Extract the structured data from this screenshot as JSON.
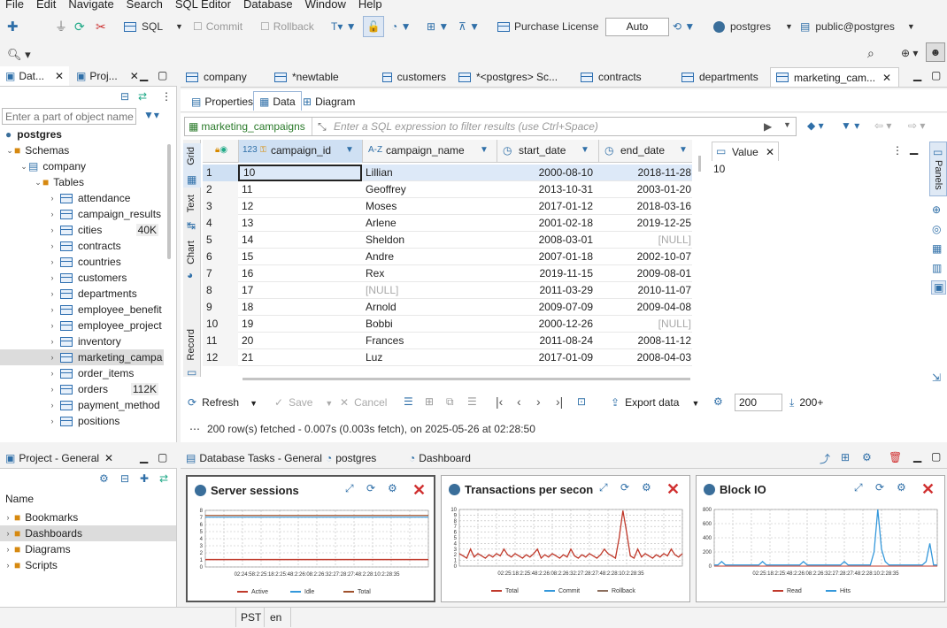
{
  "menu": [
    "File",
    "Edit",
    "Navigate",
    "Search",
    "SQL Editor",
    "Database",
    "Window",
    "Help"
  ],
  "toolbar": {
    "sql": "SQL",
    "commit": "Commit",
    "rollback": "Rollback",
    "purchase": "Purchase License",
    "auto": "Auto",
    "connection": "postgres",
    "schema": "public@postgres"
  },
  "nav": {
    "tab1": "Dat...",
    "tab2": "Proj...",
    "filter_placeholder": "Enter a part of object name h"
  },
  "tree": {
    "root": "postgres",
    "schemas": "Schemas",
    "company": "company",
    "tables": "Tables",
    "items": [
      {
        "name": "attendance",
        "size": ""
      },
      {
        "name": "campaign_results",
        "size": ""
      },
      {
        "name": "cities",
        "size": "40K"
      },
      {
        "name": "contracts",
        "size": ""
      },
      {
        "name": "countries",
        "size": ""
      },
      {
        "name": "customers",
        "size": ""
      },
      {
        "name": "departments",
        "size": ""
      },
      {
        "name": "employee_benefit",
        "size": ""
      },
      {
        "name": "employee_project",
        "size": ""
      },
      {
        "name": "inventory",
        "size": ""
      },
      {
        "name": "marketing_campa",
        "size": ""
      },
      {
        "name": "order_items",
        "size": ""
      },
      {
        "name": "orders",
        "size": "112K"
      },
      {
        "name": "payment_method",
        "size": ""
      },
      {
        "name": "positions",
        "size": ""
      }
    ]
  },
  "editor_tabs": [
    "company",
    "*newtable",
    "customers",
    "*<postgres> Sc...",
    "contracts",
    "departments",
    "marketing_cam..."
  ],
  "sub_tabs": [
    "Properties",
    "Data",
    "Diagram"
  ],
  "filter": {
    "table": "marketing_campaigns",
    "placeholder": "Enter a SQL expression to filter results (use Ctrl+Space)"
  },
  "side_tabs": [
    "Grid",
    "Text",
    "Chart",
    "Record"
  ],
  "columns": [
    {
      "type": "123",
      "name": "campaign_id"
    },
    {
      "type": "A-Z",
      "name": "campaign_name"
    },
    {
      "type": "",
      "name": "start_date"
    },
    {
      "type": "",
      "name": "end_date"
    }
  ],
  "rows": [
    [
      "1",
      "10",
      "Lillian",
      "2000-08-10",
      "2018-11-28"
    ],
    [
      "2",
      "11",
      "Geoffrey",
      "2013-10-31",
      "2003-01-20"
    ],
    [
      "3",
      "12",
      "Moses",
      "2017-01-12",
      "2018-03-16"
    ],
    [
      "4",
      "13",
      "Arlene",
      "2001-02-18",
      "2019-12-25"
    ],
    [
      "5",
      "14",
      "Sheldon",
      "2008-03-01",
      "[NULL]"
    ],
    [
      "6",
      "15",
      "Andre",
      "2007-01-18",
      "2002-10-07"
    ],
    [
      "7",
      "16",
      "Rex",
      "2019-11-15",
      "2009-08-01"
    ],
    [
      "8",
      "17",
      "[NULL]",
      "2011-03-29",
      "2010-11-07"
    ],
    [
      "9",
      "18",
      "Arnold",
      "2009-07-09",
      "2009-04-08"
    ],
    [
      "10",
      "19",
      "Bobbi",
      "2000-12-26",
      "[NULL]"
    ],
    [
      "11",
      "20",
      "Frances",
      "2011-08-24",
      "2008-11-12"
    ],
    [
      "12",
      "21",
      "Luz",
      "2017-01-09",
      "2008-04-03"
    ]
  ],
  "value_panel": {
    "title": "Value",
    "value": "10"
  },
  "panels_label": "Panels",
  "bottom_bar": {
    "refresh": "Refresh",
    "save": "Save",
    "cancel": "Cancel",
    "export": "Export data",
    "fetch_size": "200",
    "fetch_more": "200+"
  },
  "status": "200 row(s) fetched - 0.007s (0.003s fetch), on 2025-05-26 at 02:28:50",
  "project": {
    "title": "Project - General",
    "header": "Name",
    "items": [
      "Bookmarks",
      "Dashboards",
      "Diagrams",
      "Scripts"
    ]
  },
  "dash_tabs": [
    "Database Tasks - General",
    "postgres",
    "Dashboard"
  ],
  "cards": [
    {
      "title": "Server sessions",
      "legend": [
        "Active",
        "Idle",
        "Total"
      ],
      "legend_colors": [
        "#c0392b",
        "#3498db",
        "#a0522d"
      ],
      "yticks": [
        "8",
        "7",
        "6",
        "5",
        "4",
        "3",
        "2",
        "1",
        "0"
      ],
      "xlabels": "02:24:58:2:25:18:2:25:48:2:26:08:2:26:32:27:28:27:48:2:28:10:2:28:35"
    },
    {
      "title": "Transactions per second",
      "legend": [
        "Total",
        "Commit",
        "Rollback"
      ],
      "legend_colors": [
        "#c0392b",
        "#3498db",
        "#8b6d5c"
      ],
      "yticks": [
        "10",
        "9",
        "8",
        "7",
        "6",
        "5",
        "4",
        "3",
        "2",
        "1",
        "0"
      ],
      "xlabels": "02:25:18:2:25:48:2:26:08:2:26:32:27:28:27:48:2:28:10:2:28:35"
    },
    {
      "title": "Block IO",
      "legend": [
        "Read",
        "Hits"
      ],
      "legend_colors": [
        "#c0392b",
        "#3498db"
      ],
      "yticks": [
        "800",
        "600",
        "400",
        "200",
        "0"
      ],
      "xlabels": "02:25:18:2:25:48:2:26:08:2:26:32:27:28:27:48:2:28:10:2:28:35"
    }
  ],
  "statusbar": {
    "tz": "PST",
    "lang": "en"
  }
}
